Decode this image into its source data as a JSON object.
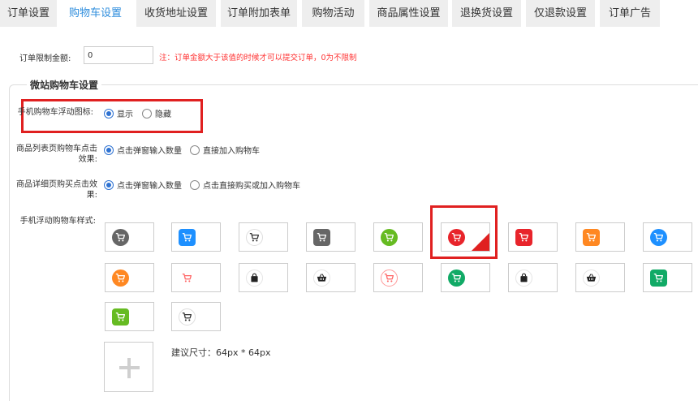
{
  "tabs": [
    {
      "label": "订单设置",
      "active": false
    },
    {
      "label": "购物车设置",
      "active": true
    },
    {
      "label": "收货地址设置",
      "active": false
    },
    {
      "label": "订单附加表单",
      "active": false
    },
    {
      "label": "购物活动",
      "active": false
    },
    {
      "label": "商品属性设置",
      "active": false
    },
    {
      "label": "退换货设置",
      "active": false
    },
    {
      "label": "仅退款设置",
      "active": false
    },
    {
      "label": "订单广告",
      "active": false
    }
  ],
  "order_limit": {
    "label": "订单限制金额:",
    "value": "0",
    "note": "注：订单金额大于该值的时候才可以提交订单，0为不限制"
  },
  "section": {
    "title": "微站购物车设置"
  },
  "float_icon": {
    "label": "手机购物车浮动图标:",
    "options": [
      {
        "label": "显示",
        "checked": true
      },
      {
        "label": "隐藏",
        "checked": false
      }
    ]
  },
  "list_click": {
    "label": "商品列表页购物车点击效果:",
    "options": [
      {
        "label": "点击弹窗输入数量",
        "checked": true
      },
      {
        "label": "直接加入购物车",
        "checked": false
      }
    ]
  },
  "detail_click": {
    "label": "商品详细页购买点击效果:",
    "options": [
      {
        "label": "点击弹窗输入数量",
        "checked": true
      },
      {
        "label": "点击直接购买或加入购物车",
        "checked": false
      }
    ]
  },
  "style": {
    "label": "手机浮动购物车样式:",
    "selected_index": 5,
    "icons": [
      {
        "name": "cart-icon",
        "shape": "circle",
        "bg": "#666666",
        "fg": "#ffffff"
      },
      {
        "name": "cart-icon",
        "shape": "square",
        "bg": "#1e90ff",
        "fg": "#ffffff"
      },
      {
        "name": "cart-icon",
        "shape": "circle",
        "bg": "#ffffff",
        "fg": "#333333",
        "border": "#dddddd"
      },
      {
        "name": "cart-icon",
        "shape": "square",
        "bg": "#666666",
        "fg": "#ffffff"
      },
      {
        "name": "cart-icon",
        "shape": "circle",
        "bg": "#66bb22",
        "fg": "#ffffff"
      },
      {
        "name": "cart-icon",
        "shape": "circle",
        "bg": "#e8242b",
        "fg": "#ffffff"
      },
      {
        "name": "cart-icon",
        "shape": "square",
        "bg": "#e8242b",
        "fg": "#ffffff"
      },
      {
        "name": "cart-icon",
        "shape": "square",
        "bg": "#ff8822",
        "fg": "#ffffff"
      },
      {
        "name": "cart-icon",
        "shape": "circle",
        "bg": "#1e90ff",
        "fg": "#ffffff"
      },
      {
        "name": "cart-icon",
        "shape": "circle",
        "bg": "#ff8822",
        "fg": "#ffffff"
      },
      {
        "name": "cart-icon",
        "shape": "square",
        "bg": "#ffffff",
        "fg": "#ff6666"
      },
      {
        "name": "bag-icon",
        "shape": "circle",
        "bg": "#ffffff",
        "fg": "#222222",
        "border": "#e5e5e5"
      },
      {
        "name": "basket-icon",
        "shape": "circle",
        "bg": "#ffffff",
        "fg": "#222222",
        "border": "#e5e5e5"
      },
      {
        "name": "cart-icon",
        "shape": "circle",
        "bg": "#ffffff",
        "fg": "#ff6666",
        "border": "#ff9999"
      },
      {
        "name": "cart-icon",
        "shape": "circle",
        "bg": "#11aa66",
        "fg": "#ffffff"
      },
      {
        "name": "bag-icon",
        "shape": "circle",
        "bg": "#ffffff",
        "fg": "#222222",
        "border": "#e5e5e5"
      },
      {
        "name": "basket-icon",
        "shape": "circle",
        "bg": "#ffffff",
        "fg": "#222222",
        "border": "#e5e5e5"
      },
      {
        "name": "cart-icon",
        "shape": "square",
        "bg": "#11aa66",
        "fg": "#ffffff"
      },
      {
        "name": "cart-icon",
        "shape": "square",
        "bg": "#66bb22",
        "fg": "#ffffff"
      },
      {
        "name": "cart-icon",
        "shape": "circle",
        "bg": "#ffffff",
        "fg": "#333333",
        "border": "#dddddd"
      }
    ],
    "size_hint": "建议尺寸：64px * 64px"
  },
  "accent_color": "#2e8ddd",
  "highlight_color": "#e02020"
}
